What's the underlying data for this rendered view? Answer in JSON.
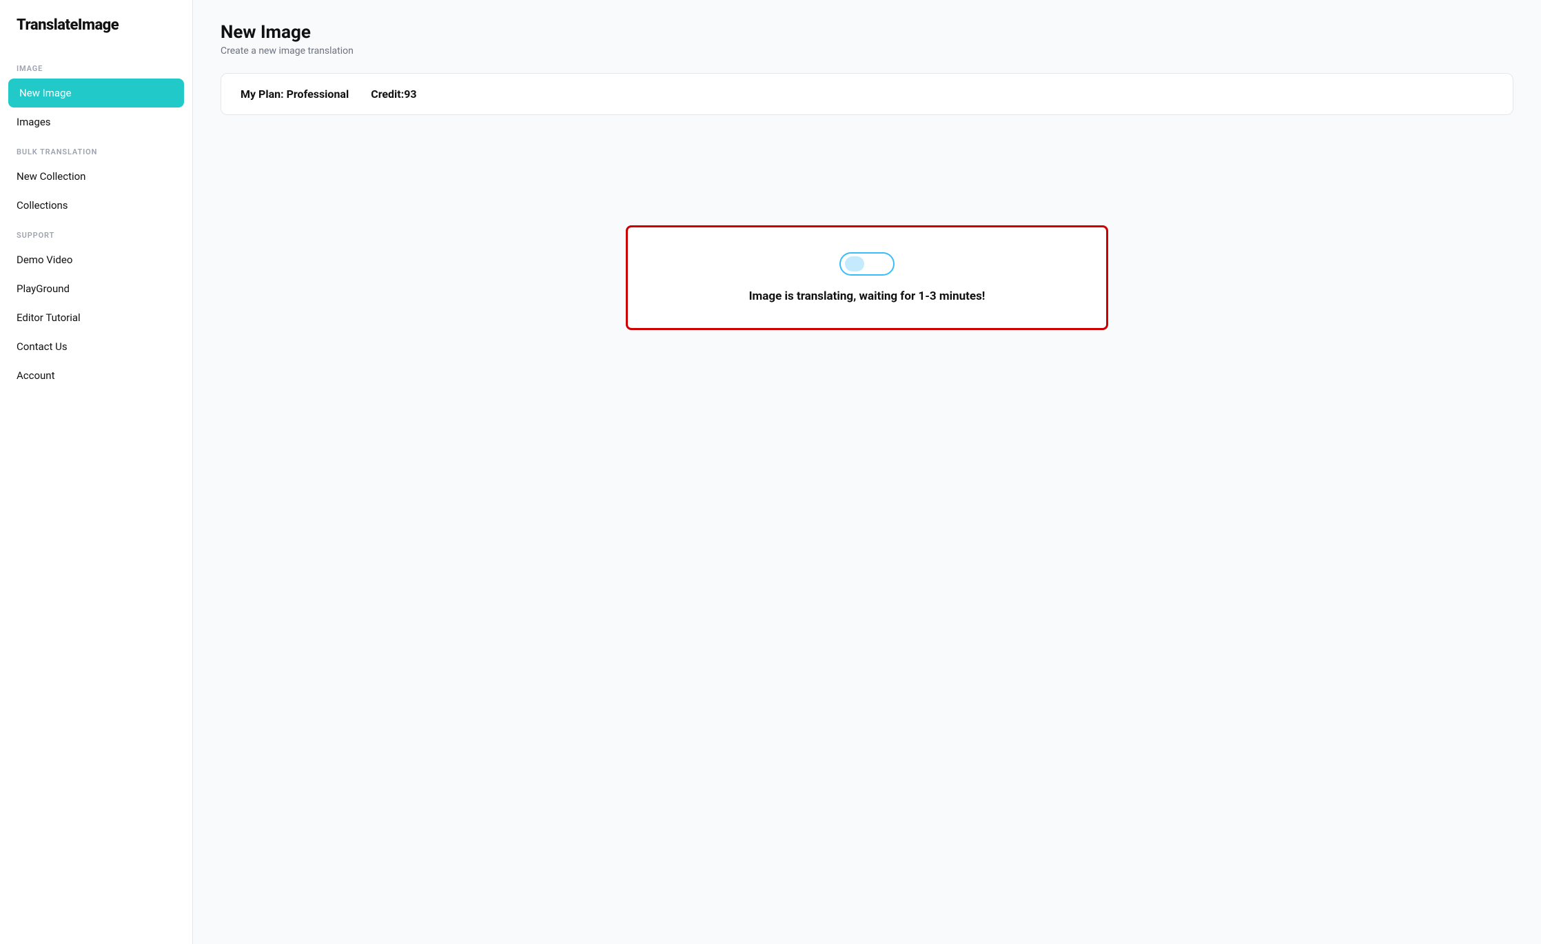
{
  "app": {
    "title": "TranslateImage"
  },
  "sidebar": {
    "sections": [
      {
        "label": "IMAGE",
        "items": [
          {
            "id": "new-image",
            "label": "New Image",
            "active": true
          },
          {
            "id": "images",
            "label": "Images",
            "active": false
          }
        ]
      },
      {
        "label": "BULK TRANSLATION",
        "items": [
          {
            "id": "new-collection",
            "label": "New Collection",
            "active": false
          },
          {
            "id": "collections",
            "label": "Collections",
            "active": false
          }
        ]
      },
      {
        "label": "SUPPORT",
        "items": [
          {
            "id": "demo-video",
            "label": "Demo Video",
            "active": false
          },
          {
            "id": "playground",
            "label": "PlayGround",
            "active": false
          },
          {
            "id": "editor-tutorial",
            "label": "Editor Tutorial",
            "active": false
          },
          {
            "id": "contact-us",
            "label": "Contact Us",
            "active": false
          },
          {
            "id": "account",
            "label": "Account",
            "active": false
          }
        ]
      }
    ]
  },
  "main": {
    "page_title": "New Image",
    "page_subtitle": "Create a new image translation",
    "plan": {
      "label": "My Plan: Professional",
      "credit_label": "Credit:93"
    },
    "status": {
      "message": "Image is translating, waiting for 1-3 minutes!"
    }
  }
}
